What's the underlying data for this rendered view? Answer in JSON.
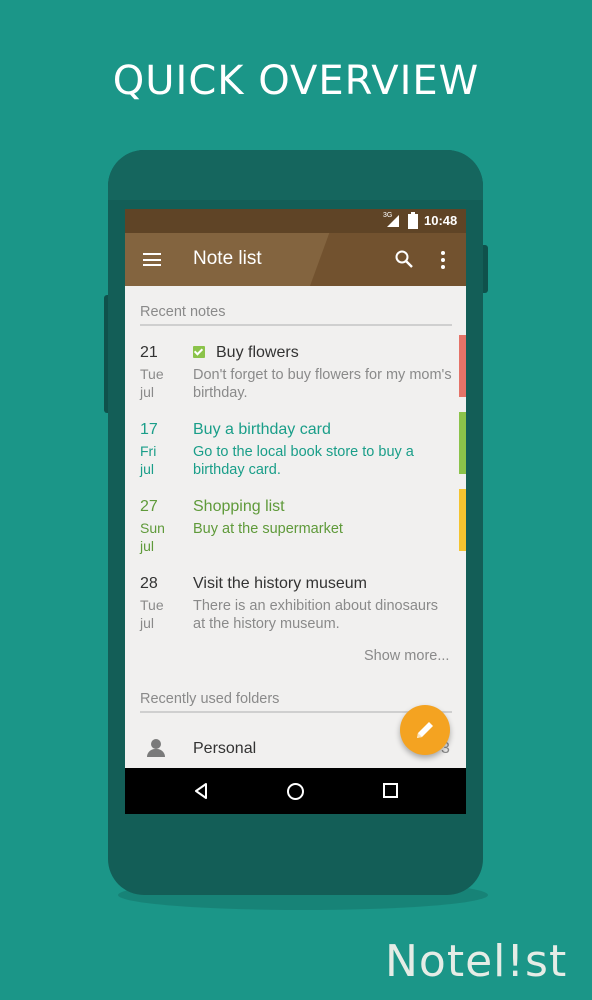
{
  "headline": "QUICK OVERVIEW",
  "status_bar": {
    "network": "3G",
    "time": "10:48"
  },
  "app_bar": {
    "title": "Note list",
    "menu_icon": "hamburger-menu-icon",
    "search_icon": "search-icon",
    "more_icon": "more-vert-icon",
    "color": "#72522f"
  },
  "recent_notes": {
    "header": "Recent notes",
    "items": [
      {
        "day": "21",
        "weekday": "Tue",
        "month": "jul",
        "title": "Buy flowers",
        "body": "Don't forget to buy flowers for my mom's birthday.",
        "checked": true,
        "color": "#e57368"
      },
      {
        "day": "17",
        "weekday": "Fri",
        "month": "jul",
        "title": "Buy a birthday card",
        "body": "Go to the local book store to buy a birthday card.",
        "checked": false,
        "color": "#8bc34a"
      },
      {
        "day": "27",
        "weekday": "Sun",
        "month": "jul",
        "title": "Shopping list",
        "body": "Buy at the supermarket",
        "checked": false,
        "color": "#f4c430"
      },
      {
        "day": "28",
        "weekday": "Tue",
        "month": "jul",
        "title": "Visit the history museum",
        "body": "There is an exhibition about dinosaurs at the history museum.",
        "checked": false,
        "color": ""
      }
    ],
    "show_more": "Show more..."
  },
  "recent_folders": {
    "header": "Recently used folders",
    "items": [
      {
        "name": "Personal",
        "count": "3",
        "icon": "person-icon"
      }
    ]
  },
  "fab_icon": "pencil-icon",
  "brand_logo": "Notel!st"
}
